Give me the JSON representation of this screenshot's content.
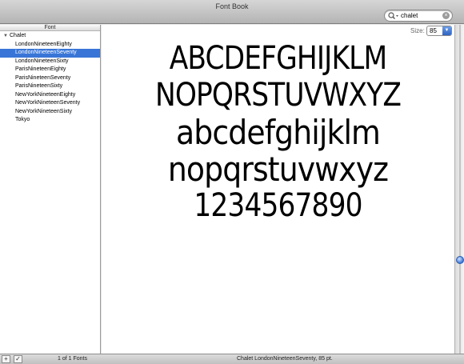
{
  "window": {
    "title": "Font Book"
  },
  "search": {
    "value": "chalet",
    "icon": "magnifier-icon",
    "clear_icon": "clear-icon"
  },
  "sidebar": {
    "header": "Font",
    "family": "Chalet",
    "faces": [
      "LondonNineteenEighty",
      "LondonNineteenSeventy",
      "LondonNineteenSixty",
      "ParisNineteenEighty",
      "ParisNineteenSeventy",
      "ParisNineteenSixty",
      "NewYorkNineteenEighty",
      "NewYorkNineteenSeventy",
      "NewYorkNineteenSixty",
      "Tokyo"
    ],
    "selected_index": 1
  },
  "preview": {
    "size_label": "Size:",
    "size_value": "85",
    "lines": [
      "ABCDEFGHIJKLM",
      "NOPQRSTUVWXYZ",
      "abcdefghijklm",
      "nopqrstuvwxyz",
      "1234567890"
    ]
  },
  "statusbar": {
    "count": "1 of 1 Fonts",
    "info": "Chalet LondonNineteenSeventy, 85 pt."
  },
  "colors": {
    "selection": "#3875d7",
    "accent": "#3b78d8"
  }
}
